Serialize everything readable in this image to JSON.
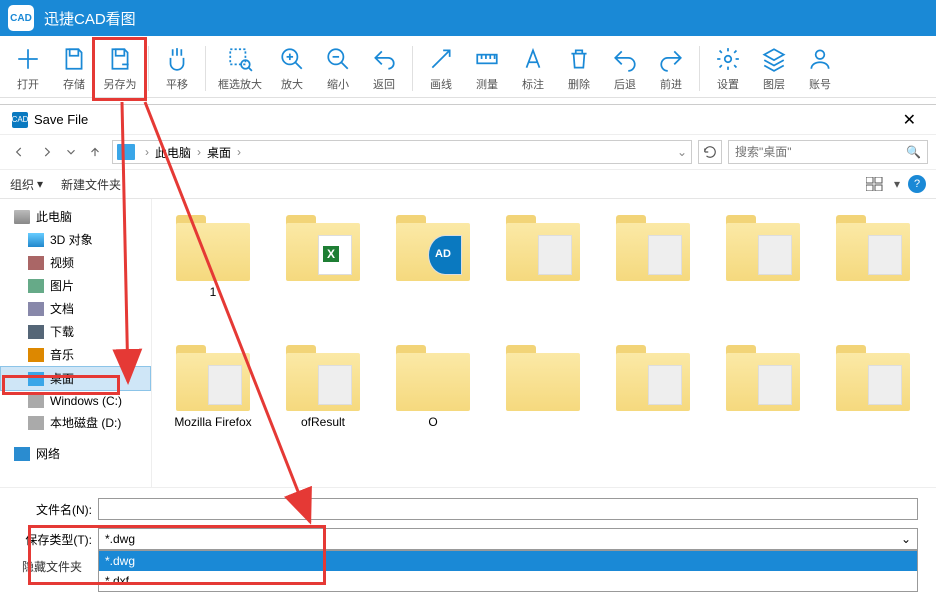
{
  "titlebar": {
    "logo_text": "CAD",
    "title": "迅捷CAD看图"
  },
  "toolbar": [
    {
      "id": "open",
      "label": "打开"
    },
    {
      "id": "save",
      "label": "存储"
    },
    {
      "id": "saveas",
      "label": "另存为"
    },
    {
      "id": "pan",
      "label": "平移"
    },
    {
      "id": "zoom-box",
      "label": "框选放大"
    },
    {
      "id": "zoom-in",
      "label": "放大"
    },
    {
      "id": "zoom-out",
      "label": "缩小"
    },
    {
      "id": "back",
      "label": "返回"
    },
    {
      "id": "line",
      "label": "画线"
    },
    {
      "id": "measure",
      "label": "测量"
    },
    {
      "id": "annotate",
      "label": "标注"
    },
    {
      "id": "delete",
      "label": "删除"
    },
    {
      "id": "undo",
      "label": "后退"
    },
    {
      "id": "redo",
      "label": "前进"
    },
    {
      "id": "settings",
      "label": "设置"
    },
    {
      "id": "layers",
      "label": "图层"
    },
    {
      "id": "account",
      "label": "账号"
    }
  ],
  "dialog": {
    "title": "Save File",
    "breadcrumb": {
      "root": "此电脑",
      "path": "桌面"
    },
    "search_placeholder": "搜索\"桌面\"",
    "cmd_organize": "组织",
    "cmd_newfolder": "新建文件夹",
    "tree": [
      {
        "k": "pc",
        "label": "此电脑",
        "cls": "ti-pc"
      },
      {
        "k": "3d",
        "label": "3D 对象",
        "cls": "ti-3d",
        "indent": true
      },
      {
        "k": "vid",
        "label": "视频",
        "cls": "ti-vid",
        "indent": true
      },
      {
        "k": "pic",
        "label": "图片",
        "cls": "ti-pic",
        "indent": true
      },
      {
        "k": "doc",
        "label": "文档",
        "cls": "ti-doc",
        "indent": true
      },
      {
        "k": "dl",
        "label": "下载",
        "cls": "ti-dl",
        "indent": true
      },
      {
        "k": "mus",
        "label": "音乐",
        "cls": "ti-mus",
        "indent": true
      },
      {
        "k": "desk",
        "label": "桌面",
        "cls": "ti-desk",
        "indent": true,
        "selected": true
      },
      {
        "k": "c",
        "label": "Windows (C:)",
        "cls": "ti-c",
        "indent": true
      },
      {
        "k": "d",
        "label": "本地磁盘 (D:)",
        "cls": "ti-d",
        "indent": true
      },
      {
        "k": "net",
        "label": "网络",
        "cls": "ti-net"
      }
    ],
    "files_row1": [
      {
        "label": "1",
        "overlay": ""
      },
      {
        "label": "",
        "overlay": "excel"
      },
      {
        "label": "",
        "overlay": "cad"
      },
      {
        "label": "",
        "overlay": "blur"
      },
      {
        "label": "",
        "overlay": "blur"
      },
      {
        "label": "",
        "overlay": "blur"
      },
      {
        "label": "",
        "overlay": "blur"
      }
    ],
    "files_row2": [
      {
        "label": "Mozilla Firefox",
        "overlay": "blur"
      },
      {
        "label": "ofResult",
        "overlay": "blur"
      },
      {
        "label": "O",
        "overlay": ""
      },
      {
        "label": "",
        "overlay": ""
      },
      {
        "label": "",
        "overlay": "blur"
      },
      {
        "label": "",
        "overlay": "blur"
      },
      {
        "label": "",
        "overlay": "blur"
      }
    ],
    "filename_label": "文件名(N):",
    "filetype_label": "保存类型(T):",
    "filetype_value": "*.dwg",
    "filetype_options": [
      "*.dwg",
      "*.dxf"
    ],
    "hide_folders": "隐藏文件夹"
  }
}
